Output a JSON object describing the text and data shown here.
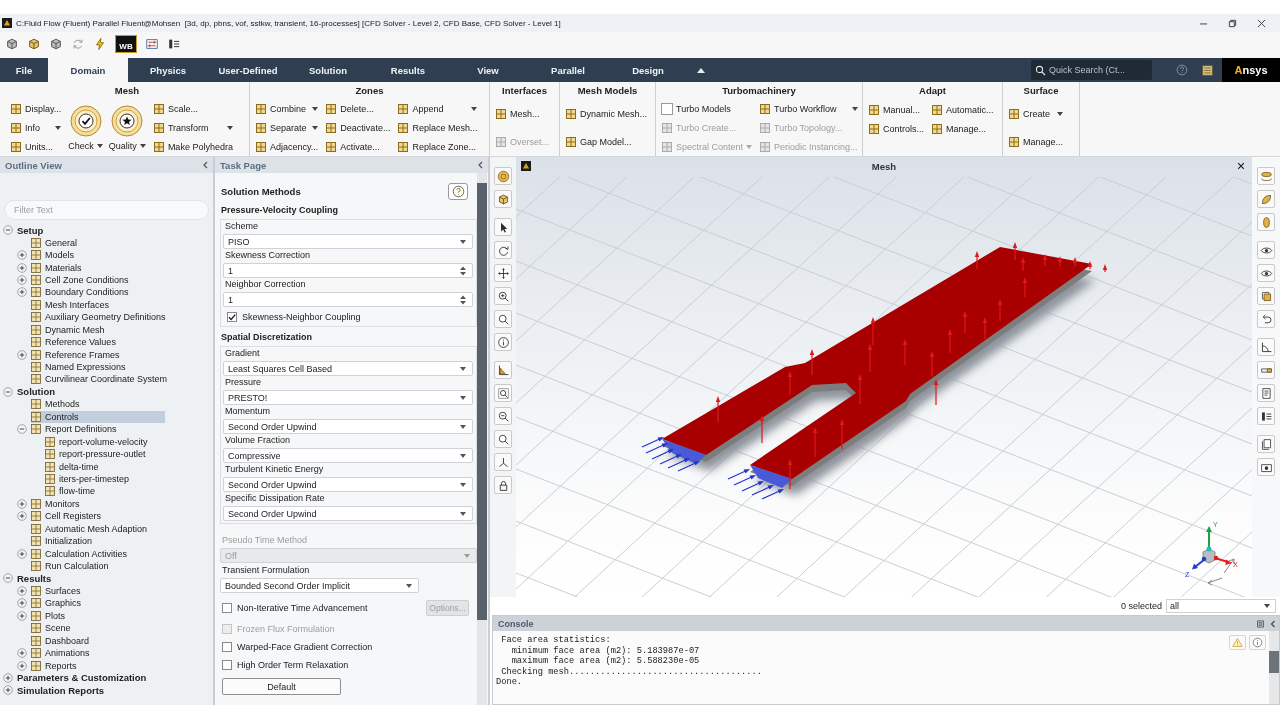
{
  "window": {
    "title": "C:Fluid Flow (Fluent) Parallel Fluent@Mohsen  [3d, dp, pbns, vof, sstkw, transient, 16-processes] [CFD Solver - Level 2, CFD Base, CFD Solver - Level 1]"
  },
  "quick_access": {
    "workbench_logo": "WB"
  },
  "ribbon": {
    "tabs": [
      {
        "label": "File",
        "selected": false
      },
      {
        "label": "Domain",
        "selected": true
      },
      {
        "label": "Physics",
        "selected": false
      },
      {
        "label": "User-Defined",
        "selected": false
      },
      {
        "label": "Solution",
        "selected": false
      },
      {
        "label": "Results",
        "selected": false
      },
      {
        "label": "View",
        "selected": false
      },
      {
        "label": "Parallel",
        "selected": false
      },
      {
        "label": "Design",
        "selected": false
      }
    ],
    "search": {
      "placeholder": "Quick Search (Ct..."
    },
    "brand": "Ansys",
    "groups": [
      {
        "title": "Mesh",
        "columns": [
          [
            {
              "kind": "button",
              "label": "Display...",
              "menu": false,
              "disabled": false
            },
            {
              "kind": "button",
              "label": "Info",
              "menu": true,
              "disabled": false
            },
            {
              "kind": "button",
              "label": "Units...",
              "menu": false,
              "disabled": false
            }
          ],
          [
            {
              "kind": "large",
              "label": "Check",
              "menu": true,
              "disabled": false
            }
          ],
          [
            {
              "kind": "large",
              "label": "Quality",
              "menu": true,
              "disabled": false
            }
          ],
          [
            {
              "kind": "button",
              "label": "Scale...",
              "menu": false,
              "disabled": false
            },
            {
              "kind": "button",
              "label": "Transform",
              "menu": true,
              "disabled": false
            },
            {
              "kind": "button",
              "label": "Make Polyhedra",
              "menu": false,
              "disabled": false
            }
          ]
        ]
      },
      {
        "title": "Zones",
        "columns": [
          [
            {
              "kind": "button",
              "label": "Combine",
              "menu": true,
              "disabled": false
            },
            {
              "kind": "button",
              "label": "Separate",
              "menu": true,
              "disabled": false
            },
            {
              "kind": "button",
              "label": "Adjacency...",
              "menu": false,
              "disabled": false
            }
          ],
          [
            {
              "kind": "button",
              "label": "Delete...",
              "menu": false,
              "disabled": false
            },
            {
              "kind": "button",
              "label": "Deactivate...",
              "menu": false,
              "disabled": false
            },
            {
              "kind": "button",
              "label": "Activate...",
              "menu": false,
              "disabled": false
            }
          ],
          [
            {
              "kind": "button",
              "label": "Append",
              "menu": true,
              "disabled": false
            },
            {
              "kind": "button",
              "label": "Replace Mesh...",
              "menu": false,
              "disabled": false
            },
            {
              "kind": "button",
              "label": "Replace Zone...",
              "menu": false,
              "disabled": false
            }
          ]
        ]
      },
      {
        "title": "Interfaces",
        "columns": [
          [
            {
              "kind": "button",
              "label": "Mesh...",
              "menu": false,
              "disabled": false
            },
            {
              "kind": "button",
              "label": "Overset...",
              "menu": false,
              "disabled": true
            }
          ]
        ]
      },
      {
        "title": "Mesh Models",
        "columns": [
          [
            {
              "kind": "button",
              "label": "Dynamic Mesh...",
              "menu": false,
              "disabled": false
            },
            {
              "kind": "button",
              "label": "Gap Model...",
              "menu": false,
              "disabled": false
            }
          ]
        ]
      },
      {
        "title": "Turbomachinery",
        "columns": [
          [
            {
              "kind": "toggle",
              "label": "Turbo Models",
              "checked": false,
              "menu": false,
              "disabled": false
            },
            {
              "kind": "button",
              "label": "Turbo Create...",
              "menu": false,
              "disabled": true
            },
            {
              "kind": "button",
              "label": "Spectral Content",
              "menu": true,
              "disabled": true
            }
          ],
          [
            {
              "kind": "button",
              "label": "Turbo Workflow",
              "menu": true,
              "disabled": false
            },
            {
              "kind": "button",
              "label": "Turbo Topology...",
              "menu": false,
              "disabled": true
            },
            {
              "kind": "button",
              "label": "Periodic Instancing...",
              "menu": false,
              "disabled": true
            }
          ]
        ]
      },
      {
        "title": "Adapt",
        "columns": [
          [
            {
              "kind": "button",
              "label": "Manual...",
              "menu": false,
              "disabled": false
            },
            {
              "kind": "button",
              "label": "Controls...",
              "menu": false,
              "disabled": false
            }
          ],
          [
            {
              "kind": "button",
              "label": "Automatic...",
              "menu": false,
              "disabled": false
            },
            {
              "kind": "button",
              "label": "Manage...",
              "menu": false,
              "disabled": false
            }
          ]
        ]
      },
      {
        "title": "Surface",
        "columns": [
          [
            {
              "kind": "button",
              "label": "Create",
              "menu": true,
              "disabled": false
            },
            {
              "kind": "button",
              "label": "Manage...",
              "menu": false,
              "disabled": false
            }
          ]
        ]
      }
    ]
  },
  "outline": {
    "title": "Outline View",
    "filter": {
      "placeholder": "Filter Text"
    },
    "tree": [
      {
        "label": "Setup",
        "expanded": true,
        "selected": false,
        "children": [
          {
            "label": "General",
            "selected": false
          },
          {
            "label": "Models",
            "expanded": false,
            "selected": false
          },
          {
            "label": "Materials",
            "expanded": false,
            "selected": false
          },
          {
            "label": "Cell Zone Conditions",
            "expanded": false,
            "selected": false
          },
          {
            "label": "Boundary Conditions",
            "expanded": false,
            "selected": false
          },
          {
            "label": "Mesh Interfaces",
            "selected": false
          },
          {
            "label": "Auxiliary Geometry Definitions",
            "selected": false
          },
          {
            "label": "Dynamic Mesh",
            "selected": false
          },
          {
            "label": "Reference Values",
            "selected": false
          },
          {
            "label": "Reference Frames",
            "expanded": false,
            "selected": false
          },
          {
            "label": "Named Expressions",
            "selected": false
          },
          {
            "label": "Curvilinear Coordinate System",
            "selected": false
          }
        ]
      },
      {
        "label": "Solution",
        "expanded": true,
        "selected": false,
        "children": [
          {
            "label": "Methods",
            "selected": false
          },
          {
            "label": "Controls",
            "selected": true
          },
          {
            "label": "Report Definitions",
            "expanded": true,
            "selected": false,
            "children": [
              {
                "label": "report-volume-velocity",
                "selected": false
              },
              {
                "label": "report-pressure-outlet",
                "selected": false
              },
              {
                "label": "delta-time",
                "selected": false
              },
              {
                "label": "iters-per-timestep",
                "selected": false
              },
              {
                "label": "flow-time",
                "selected": false
              }
            ]
          },
          {
            "label": "Monitors",
            "expanded": false,
            "selected": false
          },
          {
            "label": "Cell Registers",
            "expanded": false,
            "selected": false
          },
          {
            "label": "Automatic Mesh Adaption",
            "selected": false
          },
          {
            "label": "Initialization",
            "selected": false
          },
          {
            "label": "Calculation Activities",
            "expanded": false,
            "selected": false
          },
          {
            "label": "Run Calculation",
            "selected": false
          }
        ]
      },
      {
        "label": "Results",
        "expanded": true,
        "selected": false,
        "children": [
          {
            "label": "Surfaces",
            "expanded": false,
            "selected": false
          },
          {
            "label": "Graphics",
            "expanded": false,
            "selected": false
          },
          {
            "label": "Plots",
            "expanded": false,
            "selected": false
          },
          {
            "label": "Scene",
            "selected": false
          },
          {
            "label": "Dashboard",
            "selected": false
          },
          {
            "label": "Animations",
            "expanded": false,
            "selected": false
          },
          {
            "label": "Reports",
            "expanded": false,
            "selected": false
          }
        ]
      },
      {
        "label": "Parameters & Customization",
        "expanded": false,
        "selected": false
      },
      {
        "label": "Simulation Reports",
        "expanded": false,
        "selected": false
      }
    ]
  },
  "task_page": {
    "title": "Task Page",
    "heading": "Solution Methods",
    "sections": [
      {
        "title": "Pressure-Velocity Coupling",
        "fields": [
          {
            "kind": "dropdown",
            "label": "Scheme",
            "value": "PISO"
          },
          {
            "kind": "spinner",
            "label": "Skewness Correction",
            "value": "1"
          },
          {
            "kind": "spinner",
            "label": "Neighbor Correction",
            "value": "1"
          },
          {
            "kind": "checkbox",
            "label": "Skewness-Neighbor Coupling",
            "checked": true
          }
        ]
      },
      {
        "title": "Spatial Discretization",
        "fields": [
          {
            "kind": "dropdown",
            "label": "Gradient",
            "value": "Least Squares Cell Based"
          },
          {
            "kind": "dropdown",
            "label": "Pressure",
            "value": "PRESTO!"
          },
          {
            "kind": "dropdown",
            "label": "Momentum",
            "value": "Second Order Upwind"
          },
          {
            "kind": "dropdown",
            "label": "Volume Fraction",
            "value": "Compressive"
          },
          {
            "kind": "dropdown",
            "label": "Turbulent Kinetic Energy",
            "value": "Second Order Upwind"
          },
          {
            "kind": "dropdown",
            "label": "Specific Dissipation Rate",
            "value": "Second Order Upwind"
          }
        ]
      }
    ],
    "settings": [
      {
        "label": "Pseudo Time Method",
        "value": "Off",
        "disabled": true
      },
      {
        "label": "Transient Formulation",
        "value": "Bounded Second Order Implicit",
        "disabled": false
      }
    ],
    "options": [
      {
        "label": "Non-Iterative Time Advancement",
        "checked": false,
        "disabled": false,
        "button": {
          "label": "Options...",
          "disabled": true
        }
      },
      {
        "label": "Frozen Flux Formulation",
        "checked": false,
        "disabled": true
      },
      {
        "label": "Warped-Face Gradient Correction",
        "checked": false,
        "disabled": false
      },
      {
        "label": "High Order Term Relaxation",
        "checked": false,
        "disabled": false
      }
    ],
    "default_button": "Default"
  },
  "graphics": {
    "title": "Mesh",
    "axes": [
      "X",
      "Y",
      "Z"
    ],
    "selection": "0 selected",
    "filter": "all"
  },
  "console": {
    "title": "Console",
    "lines": [
      " Face area statistics:",
      "   minimum face area (m2): 5.183987e-07",
      "   maximum face area (m2): 5.588230e-05",
      " Checking mesh.....................................",
      "Done."
    ]
  }
}
